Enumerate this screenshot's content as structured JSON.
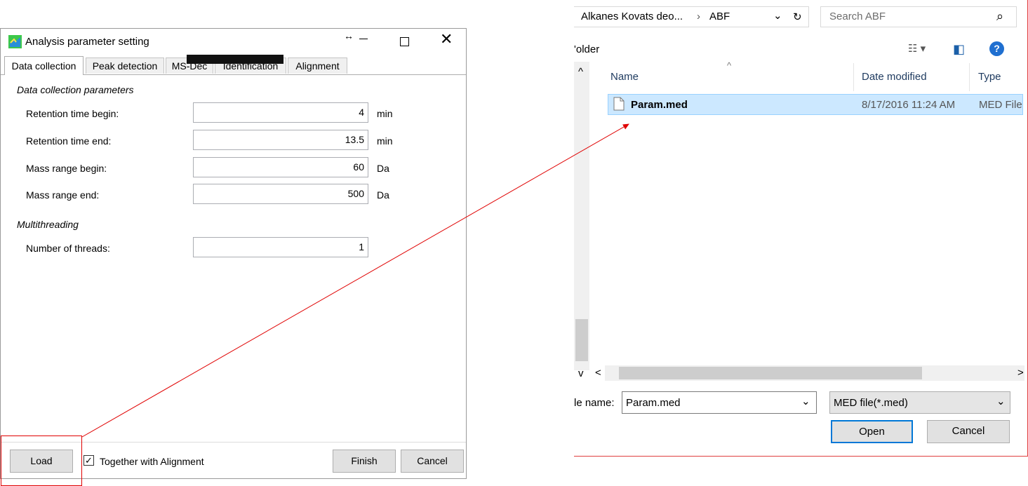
{
  "left_dialog": {
    "title": "Analysis parameter setting",
    "resize_glyph": "↔",
    "close_glyph": "✕",
    "tabs": [
      "Data collection",
      "Peak detection",
      "MS-Dec",
      "Identification",
      "Alignment"
    ],
    "data_section_title": "Data collection parameters",
    "params": [
      {
        "label": "Retention time begin:",
        "value": "4",
        "unit": "min"
      },
      {
        "label": "Retention time end:",
        "value": "13.5",
        "unit": "min"
      },
      {
        "label": "Mass range begin:",
        "value": "60",
        "unit": "Da"
      },
      {
        "label": "Mass range end:",
        "value": "500",
        "unit": "Da"
      }
    ],
    "multithread_section_title": "Multithreading",
    "threads": {
      "label": "Number of threads:",
      "value": "1"
    },
    "load_label": "Load",
    "together_label": "Together with Alignment",
    "together_checked": true,
    "check_glyph": "✓",
    "finish_label": "Finish",
    "cancel_label": "Cancel"
  },
  "file_dialog": {
    "breadcrumb": "Alkanes Kovats deo...",
    "breadcrumb_sep": "›",
    "breadcrumb_current": "ABF",
    "dropdown_glyph": "⌄",
    "refresh_glyph": "↻",
    "search_placeholder": "Search ABF",
    "search_glyph": "⌕",
    "folder_partial": "'older",
    "view_glyph": "☷ ▾",
    "pane_glyph": "◧",
    "help_glyph": "?",
    "up_glyph": "^",
    "columns": [
      "Name",
      "Date modified",
      "Type"
    ],
    "sort_glyph": "^",
    "scroll_up": "^",
    "scroll_down": "v",
    "scroll_left": "<",
    "scroll_right": ">",
    "files": [
      {
        "name": "Param.med",
        "date": "8/17/2016 11:24 AM",
        "type": "MED File"
      }
    ],
    "file_name_label": "le name:",
    "file_name_value": "Param.med",
    "file_type_value": "MED file(*.med)",
    "open_label": "Open",
    "cancel_label": "Cancel"
  },
  "colors": {
    "annotation_red": "#e00000",
    "selection_bg": "#cce8ff",
    "accent_blue": "#0078d7"
  }
}
